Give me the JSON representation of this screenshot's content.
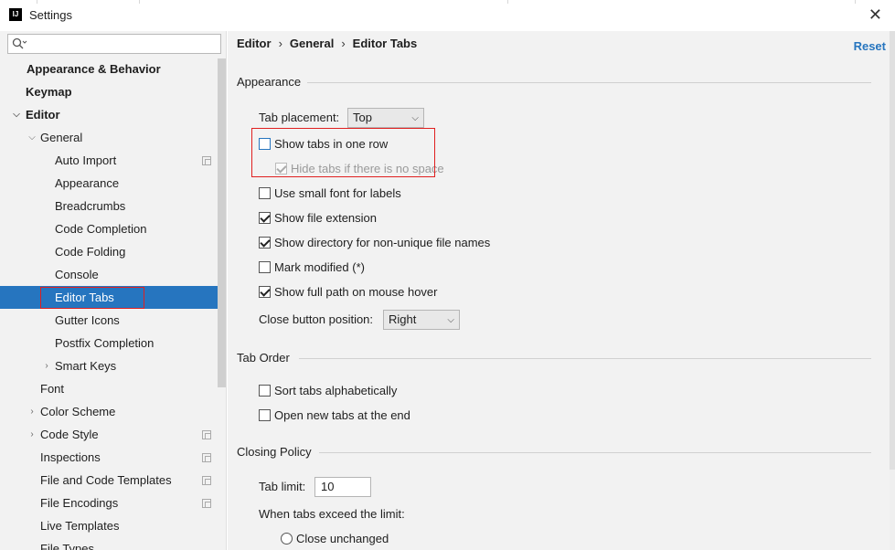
{
  "window": {
    "title": "Settings",
    "app_icon_text": "IJ",
    "close_icon": "close-icon"
  },
  "sidebar": {
    "search": {
      "placeholder": "",
      "icon": "search-icon"
    },
    "items": [
      {
        "label": "Appearance & Behavior"
      },
      {
        "label": "Keymap"
      },
      {
        "label": "Editor"
      },
      {
        "label": "General"
      },
      {
        "label": "Auto Import"
      },
      {
        "label": "Appearance"
      },
      {
        "label": "Breadcrumbs"
      },
      {
        "label": "Code Completion"
      },
      {
        "label": "Code Folding"
      },
      {
        "label": "Console"
      },
      {
        "label": "Editor Tabs"
      },
      {
        "label": "Gutter Icons"
      },
      {
        "label": "Postfix Completion"
      },
      {
        "label": "Smart Keys"
      },
      {
        "label": "Font"
      },
      {
        "label": "Color Scheme"
      },
      {
        "label": "Code Style"
      },
      {
        "label": "Inspections"
      },
      {
        "label": "File and Code Templates"
      },
      {
        "label": "File Encodings"
      },
      {
        "label": "Live Templates"
      },
      {
        "label": "File Types"
      }
    ],
    "selected": "Editor Tabs",
    "selection_color": "#2675bf"
  },
  "header": {
    "breadcrumb": {
      "part1": "Editor",
      "part2": "General",
      "part3": "Editor Tabs",
      "separator": "›"
    },
    "reset_label": "Reset",
    "link_color": "#2675bf"
  },
  "appearance": {
    "title": "Appearance",
    "tab_placement_label": "Tab placement:",
    "tab_placement_value": "Top",
    "show_tabs_one_row": {
      "label": "Show tabs in one row",
      "checked": false
    },
    "hide_tabs": {
      "label": "Hide tabs if there is no space",
      "checked": true,
      "disabled": true
    },
    "small_font": {
      "label": "Use small font for labels",
      "checked": false
    },
    "show_extension": {
      "label": "Show file extension",
      "checked": true
    },
    "show_directory": {
      "label": "Show directory for non-unique file names",
      "checked": true
    },
    "mark_modified": {
      "label": "Mark modified (*)",
      "checked": false
    },
    "show_full_path": {
      "label": "Show full path on mouse hover",
      "checked": true
    },
    "close_button_label": "Close button position:",
    "close_button_value": "Right"
  },
  "tab_order": {
    "title": "Tab Order",
    "sort_alpha": {
      "label": "Sort tabs alphabetically",
      "checked": false
    },
    "open_at_end": {
      "label": "Open new tabs at the end",
      "checked": false
    }
  },
  "closing_policy": {
    "title": "Closing Policy",
    "tab_limit_label": "Tab limit:",
    "tab_limit_value": "10",
    "exceed_label": "When tabs exceed the limit:",
    "close_unchanged": {
      "label": "Close unchanged",
      "selected": false
    }
  }
}
